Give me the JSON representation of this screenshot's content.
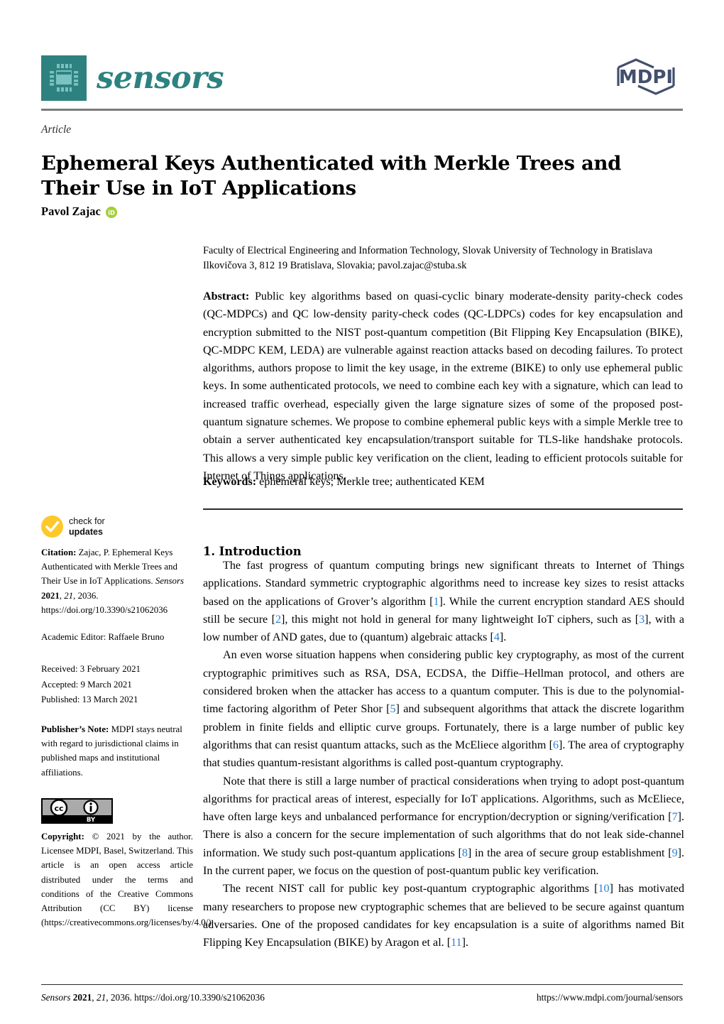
{
  "header": {
    "journal_name": "sensors",
    "publisher_logo_text": "MDPI",
    "logo_icon": "microchip-icon"
  },
  "title_block": {
    "kicker": "Article",
    "title": "Ephemeral Keys Authenticated with Merkle Trees and Their Use in IoT Applications",
    "author": "Pavol Zajac",
    "orcid_icon": "orcid-id-icon"
  },
  "affiliation": {
    "line1": "Faculty of Electrical Engineering and Information Technology, Slovak University of Technology in Bratislava",
    "line2": "Ilkovičova 3, 812 19 Bratislava, Slovakia; pavol.zajac@stuba.sk"
  },
  "abstract": {
    "label": "Abstract:",
    "text": "Public key algorithms based on quasi-cyclic binary moderate-density parity-check codes (QC-MDPCs) and QC low-density parity-check codes (QC-LDPCs) codes for key encapsulation and encryption submitted to the NIST post-quantum competition (Bit Flipping Key Encapsulation (BIKE), QC-MDPC KEM, LEDA) are vulnerable against reaction attacks based on decoding failures. To protect algorithms, authors propose to limit the key usage, in the extreme (BIKE) to only use ephemeral public keys. In some authenticated protocols, we need to combine each key with a signature, which can lead to increased traffic overhead, especially given the large signature sizes of some of the proposed post-quantum signature schemes. We propose to combine ephemeral public keys with a simple Merkle tree to obtain a server authenticated key encapsulation/transport suitable for TLS-like handshake protocols. This allows a very simple public key verification on the client, leading to efficient protocols suitable for Internet of Things applications."
  },
  "keywords": {
    "label": "Keywords:",
    "text": "ephemeral keys; Merkle tree; authenticated KEM"
  },
  "introduction": {
    "heading": "1. Introduction",
    "paragraphs": [
      {
        "parts": [
          {
            "t": "The fast progress of quantum computing brings new significant threats to Internet of Things applications. Standard symmetric cryptographic algorithms need to increase key sizes to resist attacks based on the applications of Grover’s algorithm ["
          },
          {
            "t": "1",
            "ref": true
          },
          {
            "t": "]. While the current encryption standard AES should still be secure ["
          },
          {
            "t": "2",
            "ref": true
          },
          {
            "t": "], this might not hold in general for many lightweight IoT ciphers, such as ["
          },
          {
            "t": "3",
            "ref": true
          },
          {
            "t": "], with a low number of AND gates, due to (quantum) algebraic attacks ["
          },
          {
            "t": "4",
            "ref": true
          },
          {
            "t": "]."
          }
        ]
      },
      {
        "parts": [
          {
            "t": "An even worse situation happens when considering public key cryptography, as most of the current cryptographic primitives such as RSA, DSA, ECDSA, the Diffie–Hellman protocol, and others are considered broken when the attacker has access to a quantum computer. This is due to the polynomial-time factoring algorithm of Peter Shor ["
          },
          {
            "t": "5",
            "ref": true
          },
          {
            "t": "] and subsequent algorithms that attack the discrete logarithm problem in finite fields and elliptic curve groups. Fortunately, there is a large number of public key algorithms that can resist quantum attacks, such as the McEliece algorithm ["
          },
          {
            "t": "6",
            "ref": true
          },
          {
            "t": "]. The area of cryptography that studies quantum-resistant algorithms is called post-quantum cryptography."
          }
        ]
      },
      {
        "parts": [
          {
            "t": "Note that there is still a large number of practical considerations when trying to adopt post-quantum algorithms for practical areas of interest, especially for IoT applications. Algorithms, such as McEliece, have often large keys and unbalanced performance for encryption/decryption or signing/verification ["
          },
          {
            "t": "7",
            "ref": true
          },
          {
            "t": "]. There is also a concern for the secure implementation of such algorithms that do not leak side-channel information. We study such post-quantum applications ["
          },
          {
            "t": "8",
            "ref": true
          },
          {
            "t": "] in the area of secure group establishment ["
          },
          {
            "t": "9",
            "ref": true
          },
          {
            "t": "]. In the current paper, we focus on the question of post-quantum public key verification."
          }
        ]
      },
      {
        "parts": [
          {
            "t": "The recent NIST call for public key post-quantum cryptographic algorithms ["
          },
          {
            "t": "10",
            "ref": true
          },
          {
            "t": "] has motivated many researchers to propose new cryptographic schemes that are believed to be secure against quantum adversaries. One of the proposed candidates for key encapsulation is a suite of algorithms named Bit Flipping Key Encapsulation (BIKE) by Aragon et al. ["
          },
          {
            "t": "11",
            "ref": true
          },
          {
            "t": "]."
          }
        ]
      }
    ]
  },
  "sidebar": {
    "check_updates": {
      "icon": "check-circle-icon",
      "line1": "check for",
      "line2": "updates"
    },
    "citation": {
      "label": "Citation:",
      "text_a": "Zajac, P. Ephemeral Keys Authenticated with Merkle Trees and Their Use in IoT Applications. ",
      "journal": "Sensors",
      "year": "2021",
      "volume": "21",
      "article_no": "2036.",
      "doi": "https://doi.org/10.3390/s21062036"
    },
    "academic_editor": {
      "label": "Academic Editor:",
      "value": "Raffaele Bruno"
    },
    "dates": [
      {
        "label": "Received:",
        "value": "3 February 2021"
      },
      {
        "label": "Accepted:",
        "value": "9 March 2021"
      },
      {
        "label": "Published:",
        "value": "13 March 2021"
      }
    ],
    "publishers_note": {
      "label": "Publisher’s Note:",
      "text": "MDPI stays neutral with regard to jurisdictional claims in published maps and institutional affiliations."
    },
    "cc_badge": {
      "icon": "creative-commons-by-icon",
      "cc_mark": "cc",
      "by_mark": "BY"
    },
    "copyright": {
      "label": "Copyright:",
      "text": "© 2021 by the author. Licensee MDPI, Basel, Switzerland. This article is an open access article distributed under the terms and conditions of the Creative Commons Attribution (CC BY) license (https://creativecommons.org/licenses/by/4.0/)."
    }
  },
  "footer": {
    "journal": "Sensors",
    "year": "2021",
    "volume": "21",
    "citation_tail": ", 2036. https://doi.org/10.3390/s21062036",
    "url": "https://www.mdpi.com/journal/sensors"
  },
  "colors": {
    "brand_teal": "#2d8280",
    "mdpi_navy": "#434f6e",
    "reference_blue": "#2b7fd4",
    "orcid_green": "#a6ce39",
    "check_yellow": "#fdc82a"
  }
}
